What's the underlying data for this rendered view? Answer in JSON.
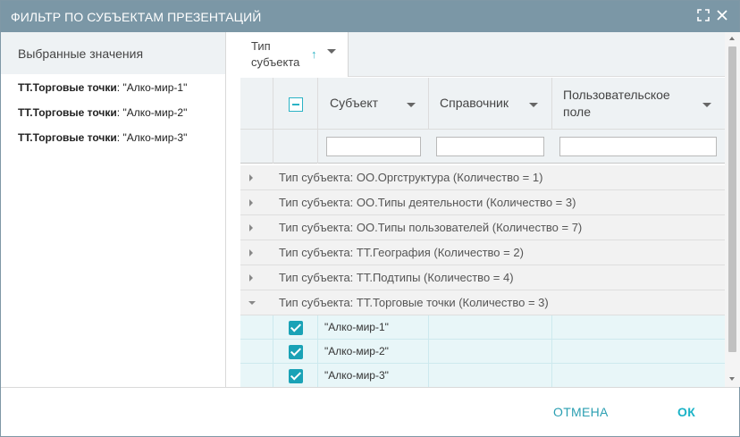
{
  "dialog": {
    "title": "ФИЛЬТР ПО СУБЪЕКТАМ ПРЕЗЕНТАЦИЙ",
    "icons": {
      "maximize": "maximize-icon",
      "close": "close-icon"
    }
  },
  "selected_panel": {
    "header": "Выбранные значения",
    "items": [
      {
        "type": "ТТ.Торговые точки",
        "value": ": \"Алко-мир-1\""
      },
      {
        "type": "ТТ.Торговые точки",
        "value": ": \"Алко-мир-2\""
      },
      {
        "type": "ТТ.Торговые точки",
        "value": ": \"Алко-мир-3\""
      }
    ]
  },
  "grid": {
    "grouping_chip": {
      "label": "Тип субъекта",
      "sort": "ascending"
    },
    "columns": {
      "subject": "Субъект",
      "reference": "Справочник",
      "custom_field": "Пользовательское поле"
    },
    "filters": {
      "subject": "",
      "reference": "",
      "custom_field": ""
    },
    "groups": [
      {
        "label": "Тип субъекта: ОО.Оргструктура (Количество = 1)",
        "expanded": false
      },
      {
        "label": "Тип субъекта: ОО.Типы деятельности (Количество = 3)",
        "expanded": false
      },
      {
        "label": "Тип субъекта: ОО.Типы пользователей (Количество = 7)",
        "expanded": false
      },
      {
        "label": "Тип субъекта: ТТ.География (Количество = 2)",
        "expanded": false
      },
      {
        "label": "Тип субъекта: ТТ.Подтипы (Количество = 4)",
        "expanded": false
      },
      {
        "label": "Тип субъекта: ТТ.Торговые точки (Количество = 3)",
        "expanded": true
      }
    ],
    "rows": [
      {
        "subject": "\"Алко-мир-1\"",
        "checked": true
      },
      {
        "subject": "\"Алко-мир-2\"",
        "checked": true
      },
      {
        "subject": "\"Алко-мир-3\"",
        "checked": true
      }
    ]
  },
  "footer": {
    "cancel": "ОТМЕНА",
    "ok": "ОК"
  },
  "colors": {
    "titlebar": "#7b97a6",
    "accent": "#1aa2b6",
    "selected_row": "#e8f6f8"
  }
}
